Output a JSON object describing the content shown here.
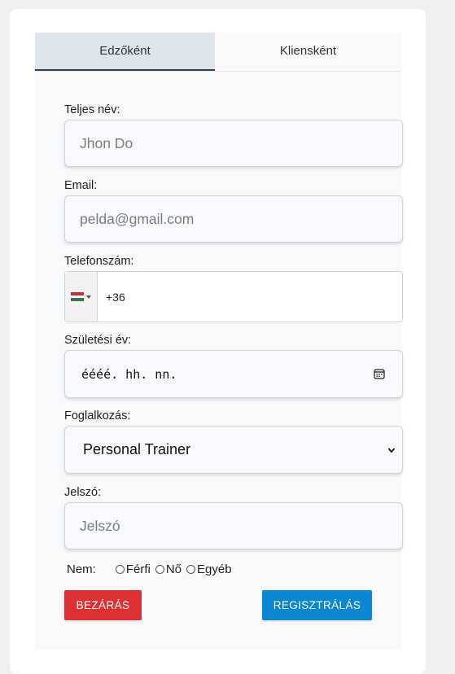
{
  "tabs": [
    {
      "label": "Edzőként",
      "active": true
    },
    {
      "label": "Kliensként",
      "active": false
    }
  ],
  "form": {
    "name_label": "Teljes név:",
    "name_placeholder": "Jhon Do",
    "email_label": "Email:",
    "email_placeholder": "pelda@gmail.com",
    "phone_label": "Telefonszám:",
    "phone_value": "+36",
    "phone_flag": "hungary-flag-icon",
    "birth_label": "Születési év:",
    "birth_placeholder": "éééé. hh. nn.",
    "occupation_label": "Foglalkozás:",
    "occupation_value": "Personal Trainer",
    "password_label": "Jelszó:",
    "password_placeholder": "Jelszó",
    "gender_label": "Nem:",
    "gender_options": [
      "Férfi",
      "Nő",
      "Egyéb"
    ]
  },
  "buttons": {
    "close_label": "BEZÁRÁS",
    "register_label": "REGISZTRÁLÁS"
  },
  "colors": {
    "close": "#dc3034",
    "register": "#0b86d1",
    "active_tab": "#dde5ec"
  }
}
